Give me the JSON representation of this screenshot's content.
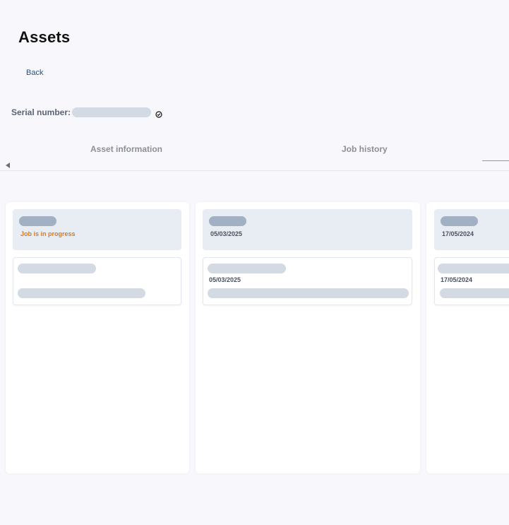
{
  "header": {
    "title": "Assets",
    "back_label": "Back"
  },
  "serial": {
    "label": "Serial number:",
    "value": "",
    "verify_icon": "check-circle-icon"
  },
  "tabs": [
    {
      "label": "Asset information"
    },
    {
      "label": "Job history"
    }
  ],
  "columns": [
    {
      "status": "Job is in progress",
      "card": {
        "date": ""
      }
    },
    {
      "date": "05/03/2025",
      "card": {
        "date": "05/03/2025"
      }
    },
    {
      "date": "17/05/2024",
      "card": {
        "date": "17/05/2024"
      }
    }
  ],
  "colors": {
    "in_progress": "#d47c24",
    "tab_indicator": "#7da1c4",
    "back_link": "#2b4f7a"
  }
}
